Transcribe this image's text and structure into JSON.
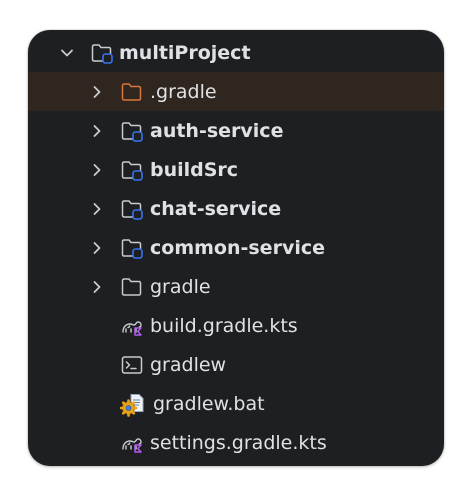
{
  "tree": {
    "root": {
      "label": "multiProject",
      "icon": "module-folder-icon"
    },
    "items": [
      {
        "label": ".gradle",
        "icon": "excluded-folder-icon",
        "bold": false,
        "expandable": true
      },
      {
        "label": "auth-service",
        "icon": "module-folder-icon",
        "bold": true,
        "expandable": true
      },
      {
        "label": "buildSrc",
        "icon": "module-folder-icon",
        "bold": true,
        "expandable": true
      },
      {
        "label": "chat-service",
        "icon": "module-folder-icon",
        "bold": true,
        "expandable": true
      },
      {
        "label": "common-service",
        "icon": "module-folder-icon",
        "bold": true,
        "expandable": true
      },
      {
        "label": "gradle",
        "icon": "folder-icon",
        "bold": false,
        "expandable": true
      },
      {
        "label": "build.gradle.kts",
        "icon": "gradle-kotlin-file-icon",
        "bold": false,
        "expandable": false
      },
      {
        "label": "gradlew",
        "icon": "shell-script-icon",
        "bold": false,
        "expandable": false
      },
      {
        "label": "gradlew.bat",
        "icon": "batch-file-icon",
        "bold": false,
        "expandable": false
      },
      {
        "label": "settings.gradle.kts",
        "icon": "gradle-kotlin-file-icon",
        "bold": false,
        "expandable": false
      }
    ]
  },
  "colors": {
    "panel_bg": "#1e1f22",
    "selected_row_bg": "#2f2620",
    "text": "#dfe1e5",
    "folder_stroke": "#c9cbcf",
    "module_badge": "#3574f0",
    "excluded_folder": "#d8763e"
  }
}
